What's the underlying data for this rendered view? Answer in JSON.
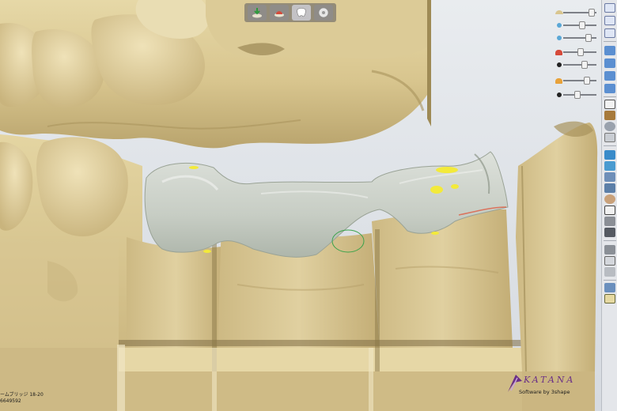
{
  "toolbar": {
    "buttons": [
      {
        "icon": "download-arrow-icon",
        "active": false
      },
      {
        "icon": "crown-preparation-icon",
        "active": false
      },
      {
        "icon": "tooth-model-icon",
        "active": true
      },
      {
        "icon": "disc-icon",
        "active": false
      }
    ]
  },
  "slider_panel": {
    "sliders": [
      {
        "icon": "arch-icon",
        "level": 0.78
      },
      {
        "icon": "dot-icon",
        "level": 0.55
      },
      {
        "icon": "dot-icon",
        "level": 0.7
      },
      {
        "icon": "crown-icon",
        "level": 0.5
      },
      {
        "icon": "dot-icon",
        "level": 0.6
      },
      {
        "icon": "crown-icon",
        "level": 0.65
      },
      {
        "icon": "dot-icon",
        "level": 0.4
      }
    ]
  },
  "case": {
    "line1": "ームブリッジ 18-20",
    "line2": "6649592"
  },
  "brand": {
    "product": "KATANA",
    "tagline": "Software by 3shape",
    "accent": "#6a2f86"
  },
  "colors": {
    "model_base": "#d6c48f",
    "model_light": "#e8dcb1",
    "model_shadow": "#a8935c",
    "crown": "#c9cfc6",
    "contact_marks": "#f3ea3a"
  }
}
